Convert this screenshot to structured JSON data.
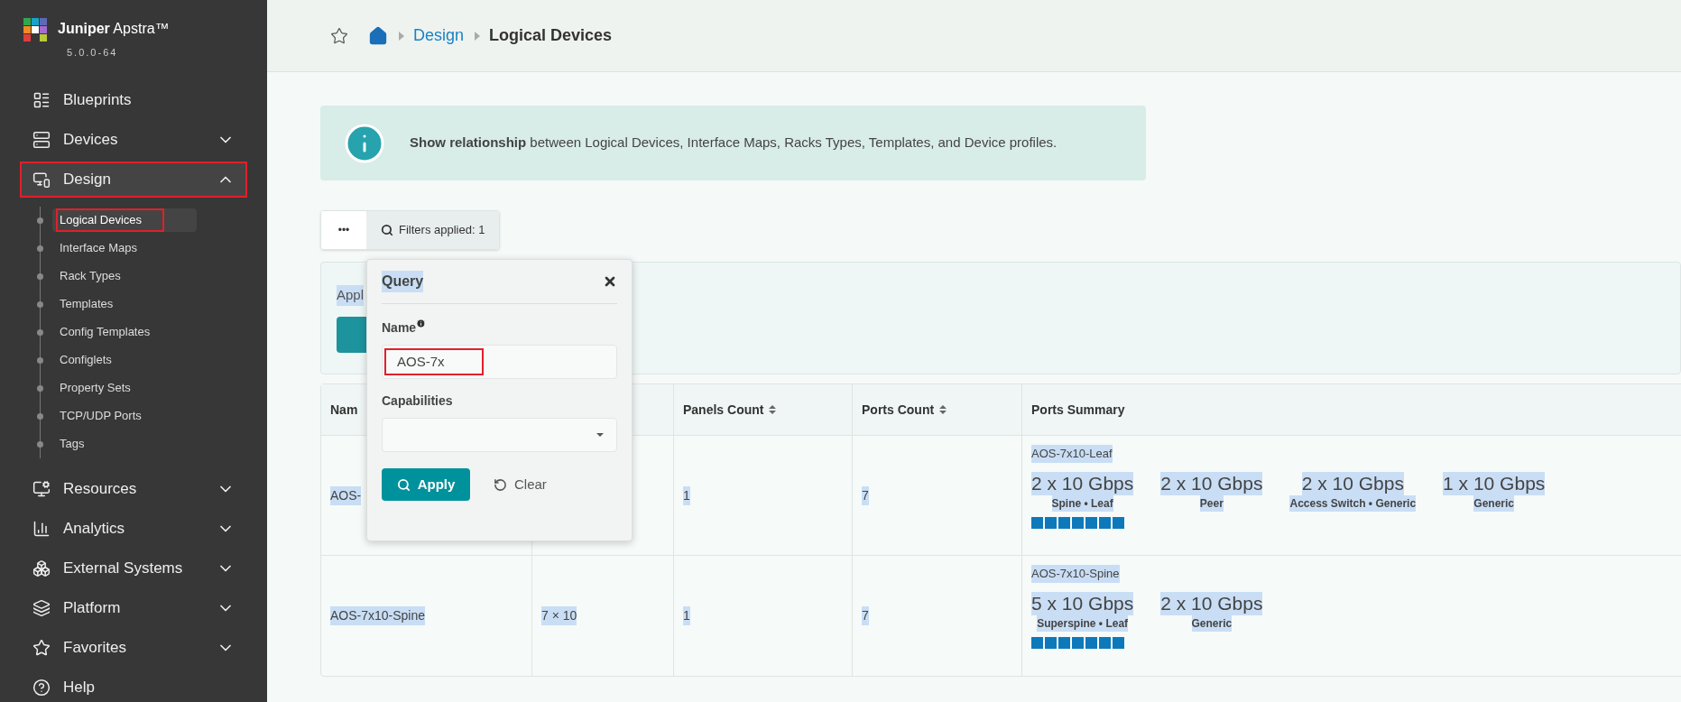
{
  "brand": {
    "name_bold": "Juniper",
    "name_rest": "Apstra™",
    "version": "5.0.0-64"
  },
  "sidebar": {
    "items": [
      {
        "label": "Blueprints",
        "expandable": false,
        "outlined": false
      },
      {
        "label": "Devices",
        "expandable": true,
        "expanded": false,
        "outlined": false
      },
      {
        "label": "Design",
        "expandable": true,
        "expanded": true,
        "outlined": true,
        "children": [
          {
            "label": "Logical Devices",
            "selected": true,
            "outlined": true
          },
          {
            "label": "Interface Maps",
            "selected": false,
            "outlined": false
          },
          {
            "label": "Rack Types",
            "selected": false,
            "outlined": false
          },
          {
            "label": "Templates",
            "selected": false,
            "outlined": false
          },
          {
            "label": "Config Templates",
            "selected": false,
            "outlined": false
          },
          {
            "label": "Configlets",
            "selected": false,
            "outlined": false
          },
          {
            "label": "Property Sets",
            "selected": false,
            "outlined": false
          },
          {
            "label": "TCP/UDP Ports",
            "selected": false,
            "outlined": false
          },
          {
            "label": "Tags",
            "selected": false,
            "outlined": false
          }
        ]
      },
      {
        "label": "Resources",
        "expandable": true,
        "expanded": false,
        "outlined": false
      },
      {
        "label": "Analytics",
        "expandable": true,
        "expanded": false,
        "outlined": false
      },
      {
        "label": "External Systems",
        "expandable": true,
        "expanded": false,
        "outlined": false
      },
      {
        "label": "Platform",
        "expandable": true,
        "expanded": false,
        "outlined": false
      },
      {
        "label": "Favorites",
        "expandable": true,
        "expanded": false,
        "outlined": false
      },
      {
        "label": "Help",
        "expandable": false,
        "outlined": false
      }
    ]
  },
  "breadcrumb": [
    {
      "label": "Design",
      "link": true
    },
    {
      "label": "Logical Devices",
      "link": false
    }
  ],
  "info": {
    "text": "**Show relationship** between Logical Devices, Interface Maps, Racks Types, Templates, and Device profiles."
  },
  "toolbar": {
    "more": "•••",
    "filters": "Filters applied: 1"
  },
  "applied_panel": {
    "text": "Appl"
  },
  "text_selected": true,
  "table": {
    "columns": [
      {
        "label": "Nam",
        "sortable": false
      },
      {
        "label": "Panels Count",
        "sortable": true
      },
      {
        "label": "Ports Count",
        "sortable": true
      },
      {
        "label": "Ports Summary",
        "sortable": false
      }
    ],
    "rows": [
      {
        "name": "AOS-",
        "panels": "1",
        "ports": "7",
        "summary": {
          "device": "AOS-7x10-Leaf",
          "groups": [
            {
              "count": "2 x 10 Gbps",
              "roles": "Spine • Leaf"
            },
            {
              "count": "2 x 10 Gbps",
              "roles": "Peer"
            },
            {
              "count": "2 x 10 Gbps",
              "roles": "Access Switch • Generic"
            },
            {
              "count": "1 x 10 Gbps",
              "roles": "Generic"
            }
          ]
        }
      },
      {
        "name": "AOS-7x10-Spine",
        "size": "7 × 10",
        "panels": "1",
        "ports": "7",
        "summary": {
          "device": "AOS-7x10-Spine",
          "groups": [
            {
              "count": "5 x 10 Gbps",
              "roles": "Superspine • Leaf"
            },
            {
              "count": "2 x 10 Gbps",
              "roles": "Generic"
            }
          ]
        }
      }
    ]
  },
  "query": {
    "title": "Query",
    "name_label": "Name",
    "name_value": "AOS-7x",
    "name_outlined": true,
    "capabilities_label": "Capabilities",
    "apply": "Apply",
    "clear": "Clear"
  }
}
